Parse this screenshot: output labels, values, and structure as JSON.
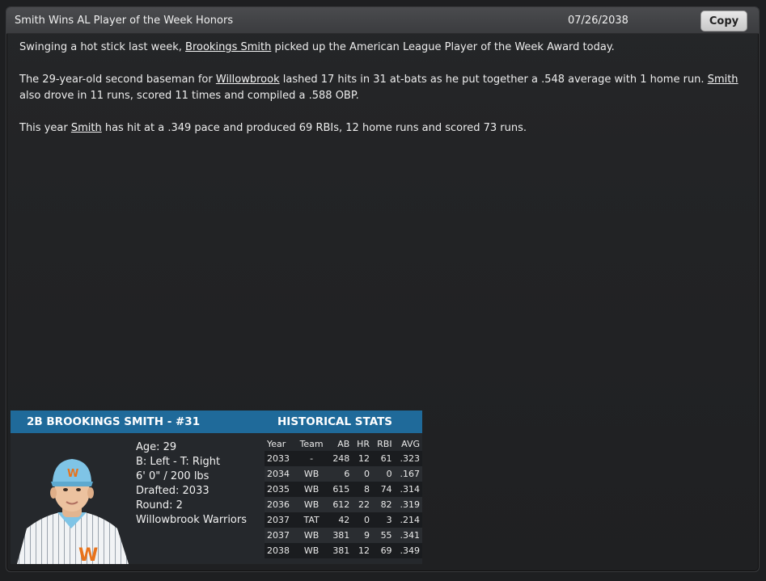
{
  "header": {
    "title": "Smith Wins AL Player of the Week Honors",
    "date": "07/26/2038",
    "copy_label": "Copy"
  },
  "article": {
    "p1": {
      "pre": "Swinging a hot stick last week, ",
      "link": "Brookings Smith",
      "post": " picked up the American League Player of the Week Award today."
    },
    "p2": {
      "pre": "The 29-year-old second baseman for ",
      "link1": "Willowbrook",
      "mid": " lashed 17 hits in 31 at-bats as he put together a .548 average with 1 home run. ",
      "link2": "Smith",
      "post": " also drove in 11 runs, scored 11 times and compiled a .588 OBP."
    },
    "p3": {
      "pre": "This year ",
      "link": "Smith",
      "post": " has hit at a .349 pace and produced 69 RBIs, 12 home runs and scored 73 runs."
    }
  },
  "player_card": {
    "header_left": "2B BROOKINGS SMITH - #31",
    "header_right": "HISTORICAL STATS",
    "bio": {
      "age": "Age: 29",
      "bats_throws": "B: Left - T: Right",
      "height_weight": "6' 0\" / 200 lbs",
      "drafted": "Drafted: 2033",
      "round": "Round: 2",
      "team": "Willowbrook Warriors"
    },
    "stats_columns": [
      "Year",
      "Team",
      "AB",
      "HR",
      "RBI",
      "AVG"
    ],
    "stats_rows": [
      [
        "2033",
        "-",
        "248",
        "12",
        "61",
        ".323"
      ],
      [
        "2034",
        "WB",
        "6",
        "0",
        "0",
        ".167"
      ],
      [
        "2035",
        "WB",
        "615",
        "8",
        "74",
        ".314"
      ],
      [
        "2036",
        "WB",
        "612",
        "22",
        "82",
        ".319"
      ],
      [
        "2037",
        "TAT",
        "42",
        "0",
        "3",
        ".214"
      ],
      [
        "2037",
        "WB",
        "381",
        "9",
        "55",
        ".341"
      ],
      [
        "2038",
        "WB",
        "381",
        "12",
        "69",
        ".349"
      ]
    ]
  },
  "colors": {
    "card_header": "#1f6a9a",
    "jersey_logo": "#e8731c",
    "cap": "#7fc4e6"
  }
}
